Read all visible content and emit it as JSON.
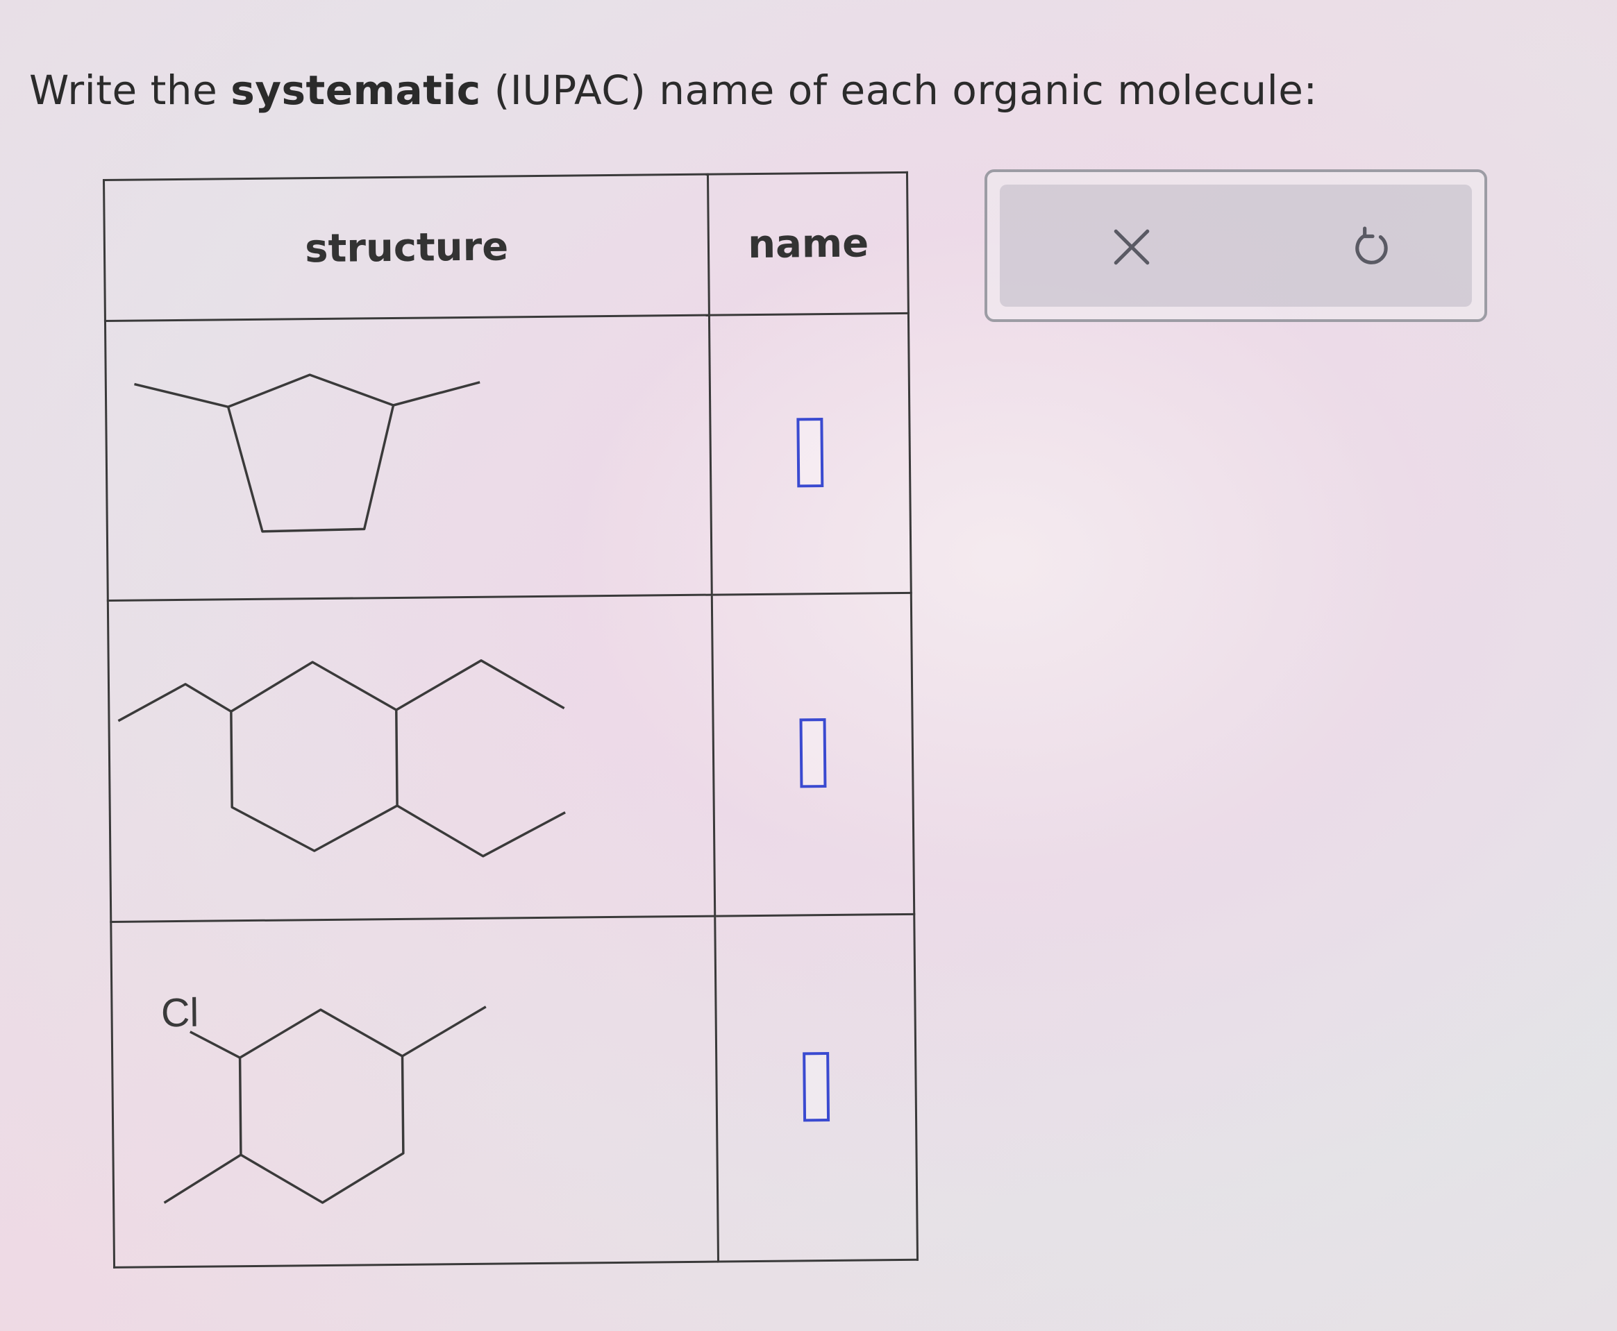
{
  "prompt": {
    "before": "Write the ",
    "bold": "systematic",
    "after": " (IUPAC) name of each organic molecule:"
  },
  "table": {
    "headers": {
      "structure": "structure",
      "name": "name"
    },
    "rows": [
      {
        "structure_label": "",
        "answer": ""
      },
      {
        "structure_label": "",
        "answer": ""
      },
      {
        "structure_label": "Cl",
        "answer": ""
      }
    ]
  },
  "toolbar": {
    "icons": [
      "close-icon",
      "undo-icon"
    ]
  },
  "colors": {
    "answer_box_border": "#3a4ad0",
    "line": "#3a3a3a",
    "icon": "#5a5a64"
  }
}
